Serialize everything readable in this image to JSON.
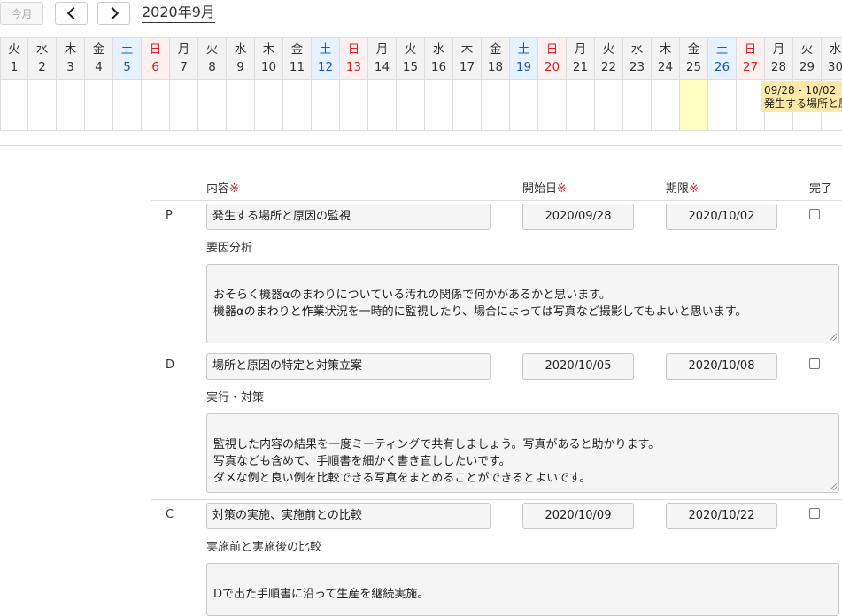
{
  "toolbar": {
    "today_label": "今月",
    "month_title": "2020年9月"
  },
  "calendar": {
    "days": [
      {
        "wd": "火",
        "d": "1",
        "type": ""
      },
      {
        "wd": "水",
        "d": "2",
        "type": ""
      },
      {
        "wd": "木",
        "d": "3",
        "type": ""
      },
      {
        "wd": "金",
        "d": "4",
        "type": ""
      },
      {
        "wd": "土",
        "d": "5",
        "type": "sat"
      },
      {
        "wd": "日",
        "d": "6",
        "type": "sun"
      },
      {
        "wd": "月",
        "d": "7",
        "type": ""
      },
      {
        "wd": "火",
        "d": "8",
        "type": ""
      },
      {
        "wd": "水",
        "d": "9",
        "type": ""
      },
      {
        "wd": "木",
        "d": "10",
        "type": ""
      },
      {
        "wd": "金",
        "d": "11",
        "type": ""
      },
      {
        "wd": "土",
        "d": "12",
        "type": "sat"
      },
      {
        "wd": "日",
        "d": "13",
        "type": "sun"
      },
      {
        "wd": "月",
        "d": "14",
        "type": ""
      },
      {
        "wd": "火",
        "d": "15",
        "type": ""
      },
      {
        "wd": "水",
        "d": "16",
        "type": ""
      },
      {
        "wd": "木",
        "d": "17",
        "type": ""
      },
      {
        "wd": "金",
        "d": "18",
        "type": ""
      },
      {
        "wd": "土",
        "d": "19",
        "type": "sat"
      },
      {
        "wd": "日",
        "d": "20",
        "type": "sun"
      },
      {
        "wd": "月",
        "d": "21",
        "type": ""
      },
      {
        "wd": "火",
        "d": "22",
        "type": ""
      },
      {
        "wd": "水",
        "d": "23",
        "type": ""
      },
      {
        "wd": "木",
        "d": "24",
        "type": ""
      },
      {
        "wd": "金",
        "d": "25",
        "type": "today"
      },
      {
        "wd": "土",
        "d": "26",
        "type": "sat"
      },
      {
        "wd": "日",
        "d": "27",
        "type": "sun"
      },
      {
        "wd": "月",
        "d": "28",
        "type": ""
      },
      {
        "wd": "火",
        "d": "29",
        "type": ""
      },
      {
        "wd": "水",
        "d": "30",
        "type": ""
      }
    ],
    "event": {
      "range": "09/28 - 10/02",
      "title": "発生する場所と原因の監視"
    }
  },
  "form": {
    "headers": {
      "content": "内容",
      "start": "開始日",
      "due": "期限",
      "done": "完了",
      "required_mark": "※"
    },
    "rows": [
      {
        "phase": "P",
        "title": "発生する場所と原因の監視",
        "start": "2020/09/28",
        "due": "2020/10/02",
        "done": false,
        "sub_label": "要因分析",
        "notes": "おそらく機器αのまわりについている汚れの関係で何かがあるかと思います。\n機器αのまわりと作業状況を一時的に監視したり、場合によっては写真など撮影してもよいと思います。"
      },
      {
        "phase": "D",
        "title": "場所と原因の特定と対策立案",
        "start": "2020/10/05",
        "due": "2020/10/08",
        "done": false,
        "sub_label": "実行・対策",
        "notes": "監視した内容の結果を一度ミーティングで共有しましょう。写真があると助かります。\n写真なども含めて、手順書を細かく書き直ししたいです。\nダメな例と良い例を比較できる写真をまとめることができるとよいです。"
      },
      {
        "phase": "C",
        "title": "対策の実施、実施前との比較",
        "start": "2020/10/09",
        "due": "2020/10/22",
        "done": false,
        "sub_label": "実施前と実施後の比較",
        "notes": "Dで出た手順書に沿って生産を継続実施。"
      }
    ]
  }
}
